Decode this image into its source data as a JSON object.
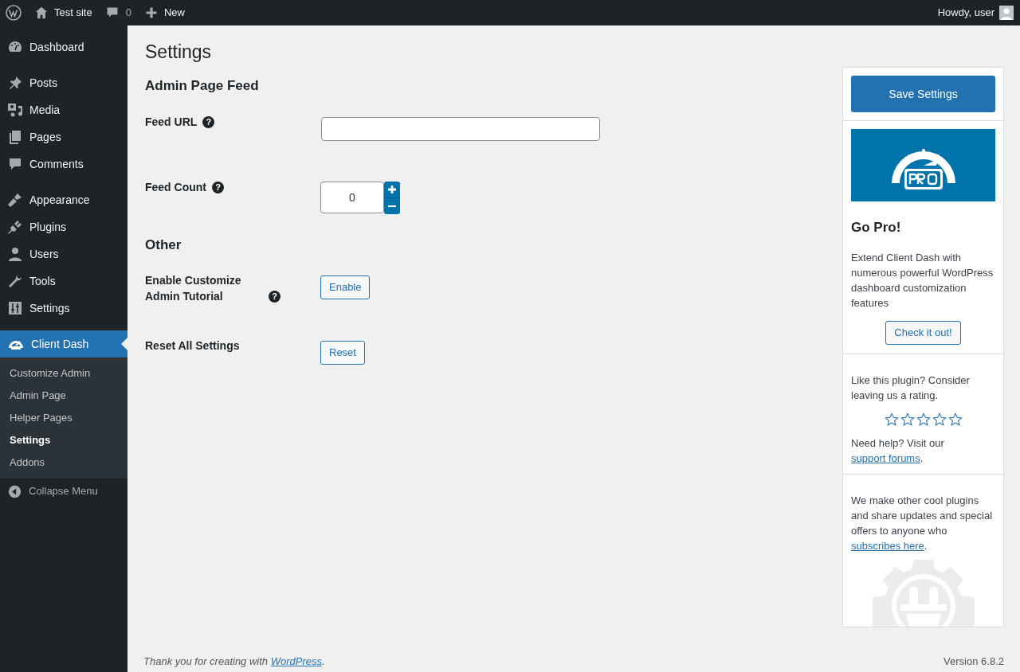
{
  "admin_bar": {
    "site": "Test site",
    "comments": "0",
    "new": "New",
    "greeting": "Howdy, user"
  },
  "sidebar": {
    "groups": [
      {
        "items": [
          {
            "label": "Dashboard",
            "selected": false
          }
        ]
      },
      {
        "items": [
          {
            "label": "Posts",
            "selected": false
          },
          {
            "label": "Media",
            "selected": false
          },
          {
            "label": "Pages",
            "selected": false
          },
          {
            "label": "Comments",
            "selected": false
          }
        ]
      },
      {
        "items": [
          {
            "label": "Appearance",
            "selected": false
          },
          {
            "label": "Plugins",
            "selected": false
          },
          {
            "label": "Users",
            "selected": false
          },
          {
            "label": "Tools",
            "selected": false
          },
          {
            "label": "Settings",
            "selected": false
          }
        ]
      },
      {
        "items": [
          {
            "label": "Client Dash",
            "selected": true,
            "children": [
              {
                "label": "Customize Admin",
                "selected": false
              },
              {
                "label": "Admin Page",
                "selected": false
              },
              {
                "label": "Helper Pages",
                "selected": false
              },
              {
                "label": "Settings",
                "selected": true
              },
              {
                "label": "Addons",
                "selected": false
              }
            ]
          }
        ]
      }
    ],
    "collapse": "Collapse Menu"
  },
  "page_title": "Settings",
  "sections": [
    {
      "title": "Admin Page Feed",
      "rows": [
        {
          "kind": "text",
          "label": "Feed URL",
          "help": "?",
          "value": ""
        },
        {
          "kind": "number",
          "label": "Feed Count",
          "help": "?",
          "value": "0"
        }
      ]
    },
    {
      "title": "Other",
      "rows": [
        {
          "kind": "button",
          "label": "Enable Customize Admin Tutorial",
          "help": "?",
          "button": "Enable"
        },
        {
          "kind": "button",
          "label": "Reset All Settings",
          "button": "Reset"
        }
      ]
    }
  ],
  "side_panel": {
    "save": "Save Settings",
    "pro_title": "Go Pro!",
    "pro_text": "Extend Client Dash with numerous powerful WordPress dashboard customization features",
    "pro_button": "Check it out!",
    "rate_text": "Like this plugin? Consider leaving us a rating.",
    "stars": 0,
    "help_before": "Need help? Visit our ",
    "help_link": "support forums",
    "help_after": ".",
    "subscribe_before": "We make other cool plugins and share updates and special offers to anyone who ",
    "subscribe_link": "subscribes here",
    "subscribe_after": "."
  },
  "footer": {
    "before": "Thank you for creating with ",
    "link": "WordPress",
    "after": ".",
    "version": "Version 6.8.2"
  }
}
